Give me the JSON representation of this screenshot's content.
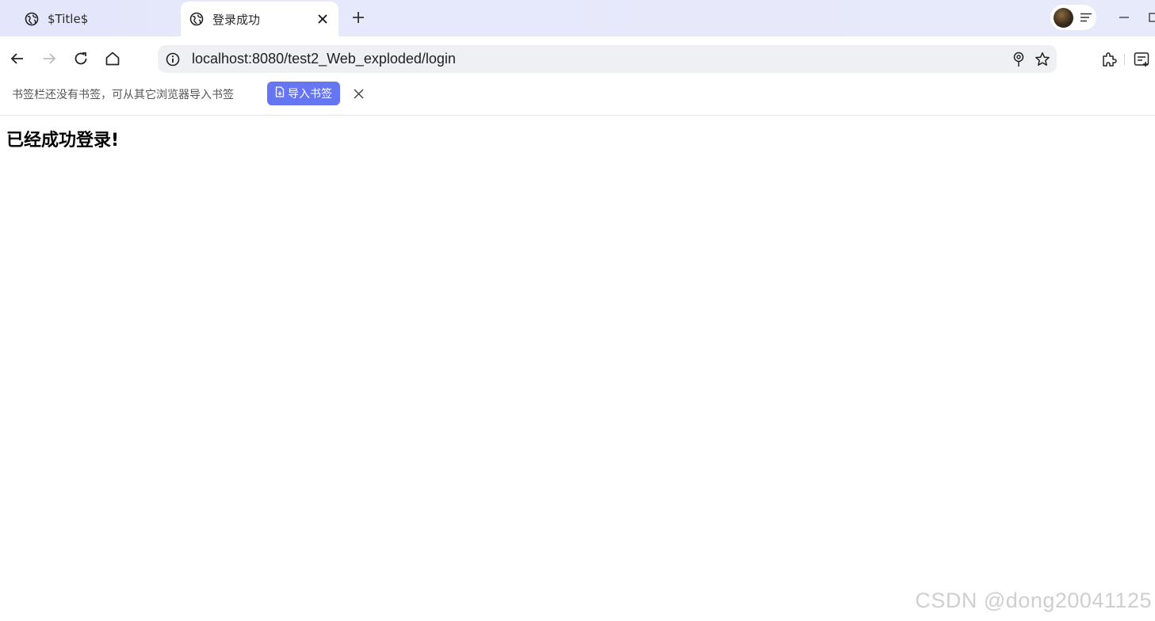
{
  "tabs": [
    {
      "label": "$Title$",
      "active": false
    },
    {
      "label": "登录成功",
      "active": true
    }
  ],
  "address_bar": {
    "url": "localhost:8080/test2_Web_exploded/login"
  },
  "bookmark_bar": {
    "prompt": "书签栏还没有书签，可从其它浏览器导入书签",
    "import_label": "导入书签"
  },
  "page": {
    "heading": "已经成功登录!"
  },
  "watermark": "CSDN @dong20041125",
  "colors": {
    "accent": "#6676f2",
    "tabstrip": "#e4e6fb",
    "omnibox": "#eef0f3"
  }
}
